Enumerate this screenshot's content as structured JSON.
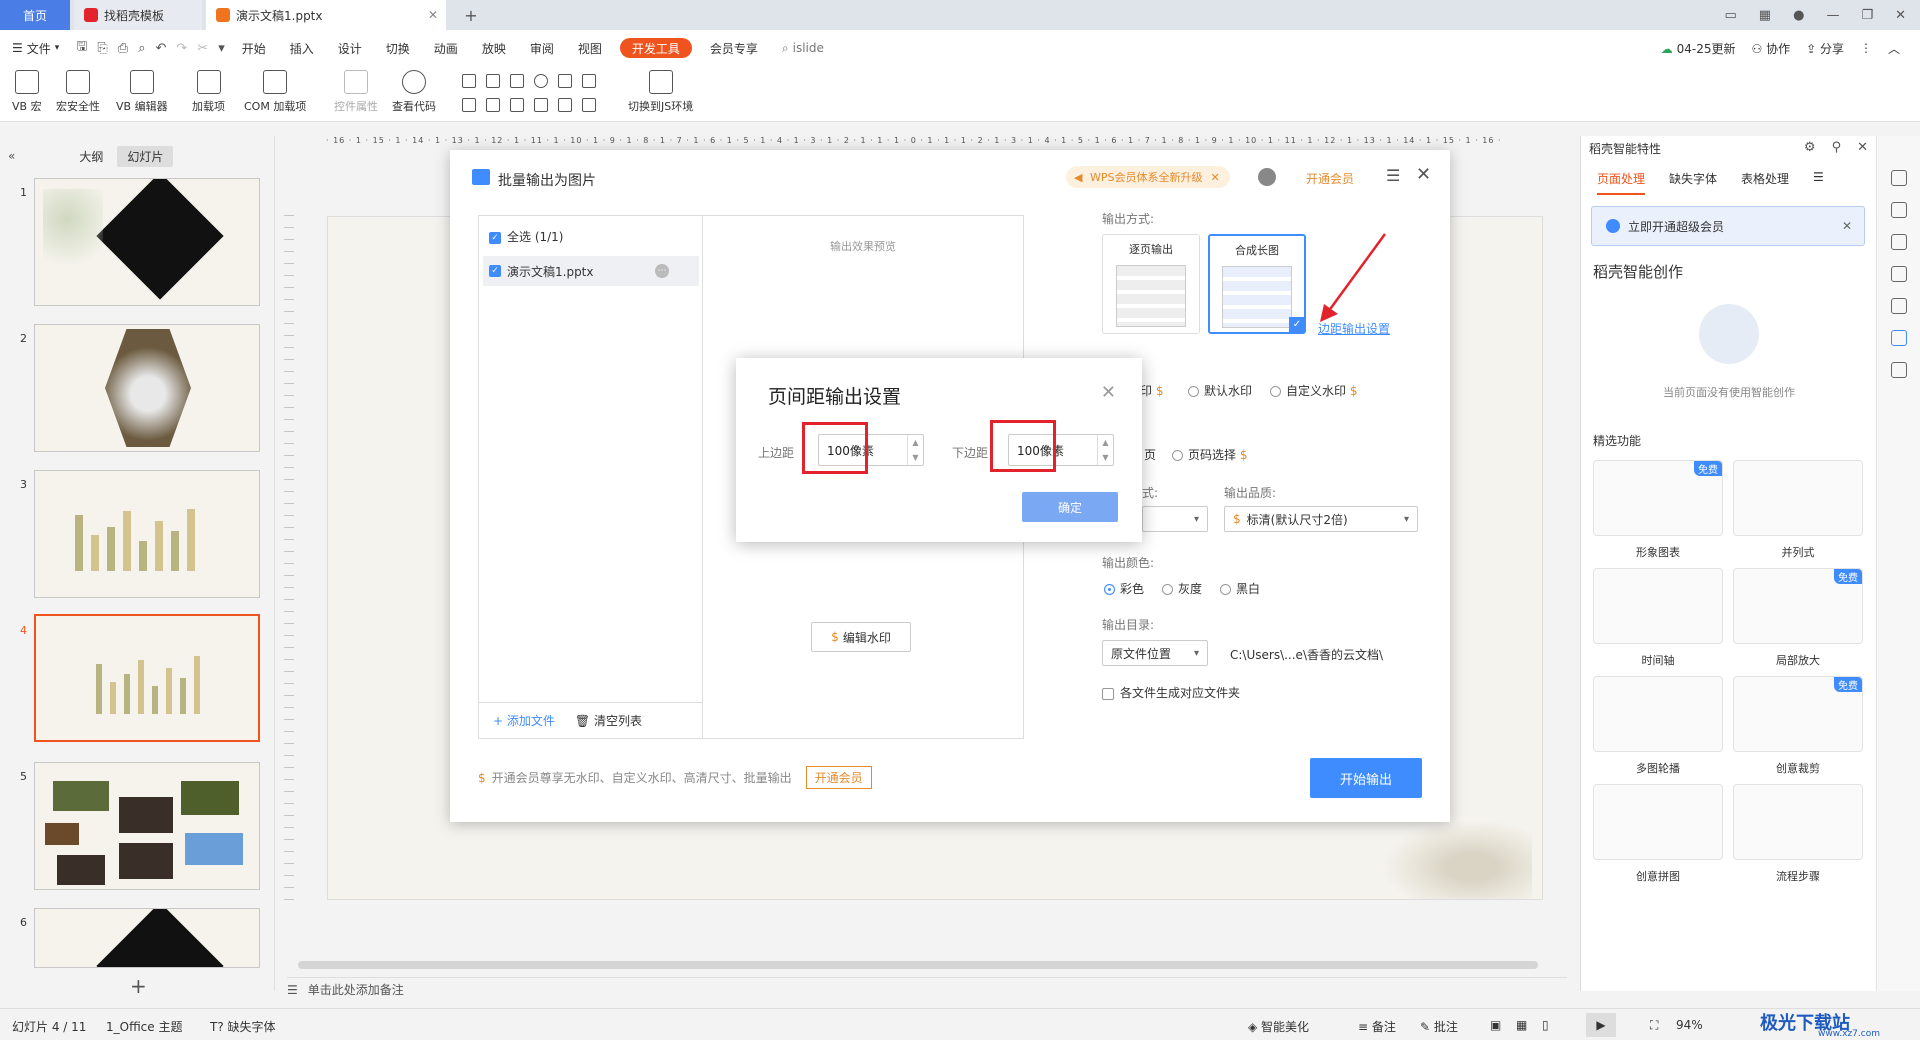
{
  "tabs": {
    "home": "首页",
    "template": "找稻壳模板",
    "doc": "演示文稿1.pptx"
  },
  "menu": {
    "file": "文件",
    "items": [
      "开始",
      "插入",
      "设计",
      "切换",
      "动画",
      "放映",
      "审阅",
      "视图"
    ],
    "active": "开发工具",
    "vip": "会员专享",
    "search_placeholder": "islide",
    "update": "04-25更新",
    "collab": "协作",
    "share": "分享"
  },
  "ribbon": {
    "vb_macro": "VB 宏",
    "macro_security": "宏安全性",
    "vb_editor": "VB 编辑器",
    "addins": "加载项",
    "com_addins": "COM 加载项",
    "control_props": "控件属性",
    "view_code": "查看代码",
    "switch_js": "切换到JS环境"
  },
  "left_panel": {
    "tab_outline": "大纲",
    "tab_slides": "幻灯片",
    "slide_numbers": [
      "1",
      "2",
      "3",
      "4",
      "5",
      "6"
    ],
    "selected_slide": 4
  },
  "ruler_text": "· 16 · 1 · 15 · 1 · 14 · 1 · 13 · 1 · 12 · 1 · 11 · 1 · 10 · 1 · 9 · 1 · 8 · 1 · 7 · 1 · 6 · 1 · 5 · 1 · 4 · 1 · 3 · 1 · 2 · 1 · 1 · 1 · 0 · 1 · 1 · 1 · 2 · 1 · 3 · 1 · 4 · 1 · 5 · 1 · 6 · 1 · 7 · 1 · 8 · 1 · 9 · 1 · 10 · 1 · 11 · 1 · 12 · 1 · 13 · 1 · 14 · 1 · 15 · 1 · 16 ·",
  "notes_placeholder": "单击此处添加备注",
  "right_panel": {
    "title": "稻壳智能特性",
    "tabs": [
      "页面处理",
      "缺失字体",
      "表格处理"
    ],
    "banner": "立即开通超级会员",
    "heading": "稻壳智能创作",
    "empty": "当前页面没有使用智能创作",
    "featured": "精选功能",
    "features": [
      "形象图表",
      "并列式",
      "时间轴",
      "局部放大",
      "多图轮播",
      "创意裁剪",
      "创意拼图",
      "流程步骤"
    ],
    "free_badge": "免费"
  },
  "status": {
    "slide_count": "幻灯片 4 / 11",
    "theme": "1_Office 主题",
    "missing_font": "缺失字体",
    "smart": "智能美化",
    "notes": "备注",
    "comments": "批注",
    "zoom": "94%",
    "watermark": "极光下载站",
    "watermark_url": "www.xz7.com"
  },
  "export_dialog": {
    "title": "批量输出为图片",
    "promo": "WPS会员体系全新升级",
    "open_vip": "开通会员",
    "select_all": "全选 (1/1)",
    "file_name": "演示文稿1.pptx",
    "preview_label": "输出效果预览",
    "add_file": "添加文件",
    "clear_list": "清空列表",
    "edit_watermark": "编辑水印",
    "output_mode_label": "输出方式:",
    "mode_single": "逐页输出",
    "mode_long": "合成长图",
    "margin_link": "边距输出设置",
    "wm_partial_prefix": "印",
    "wm_default": "默认水印",
    "wm_custom": "自定义水印",
    "page_prefix": "页",
    "page_select": "页码选择",
    "format_prefix": "式:",
    "quality_label": "输出品质:",
    "quality_value": "标清(默认尺寸2倍)",
    "color_label": "输出颜色:",
    "color_options": [
      "彩色",
      "灰度",
      "黑白"
    ],
    "dir_label": "输出目录:",
    "dir_value": "原文件位置",
    "dir_path": "C:\\Users\\...e\\香香的云文档\\",
    "subfolder": "各文件生成对应文件夹",
    "footer_note": "开通会员尊享无水印、自定义水印、高清尺寸、批量输出",
    "footer_vip": "开通会员",
    "start": "开始输出"
  },
  "margin_dialog": {
    "title": "页间距输出设置",
    "top_label": "上边距",
    "top_value": "100像素",
    "bottom_label": "下边距",
    "bottom_value": "100像素",
    "ok": "确定"
  },
  "colors": {
    "accent": "#3f8cff",
    "brand": "#f0541e",
    "highlight": "#e3232c",
    "vip": "#e48b2c"
  }
}
